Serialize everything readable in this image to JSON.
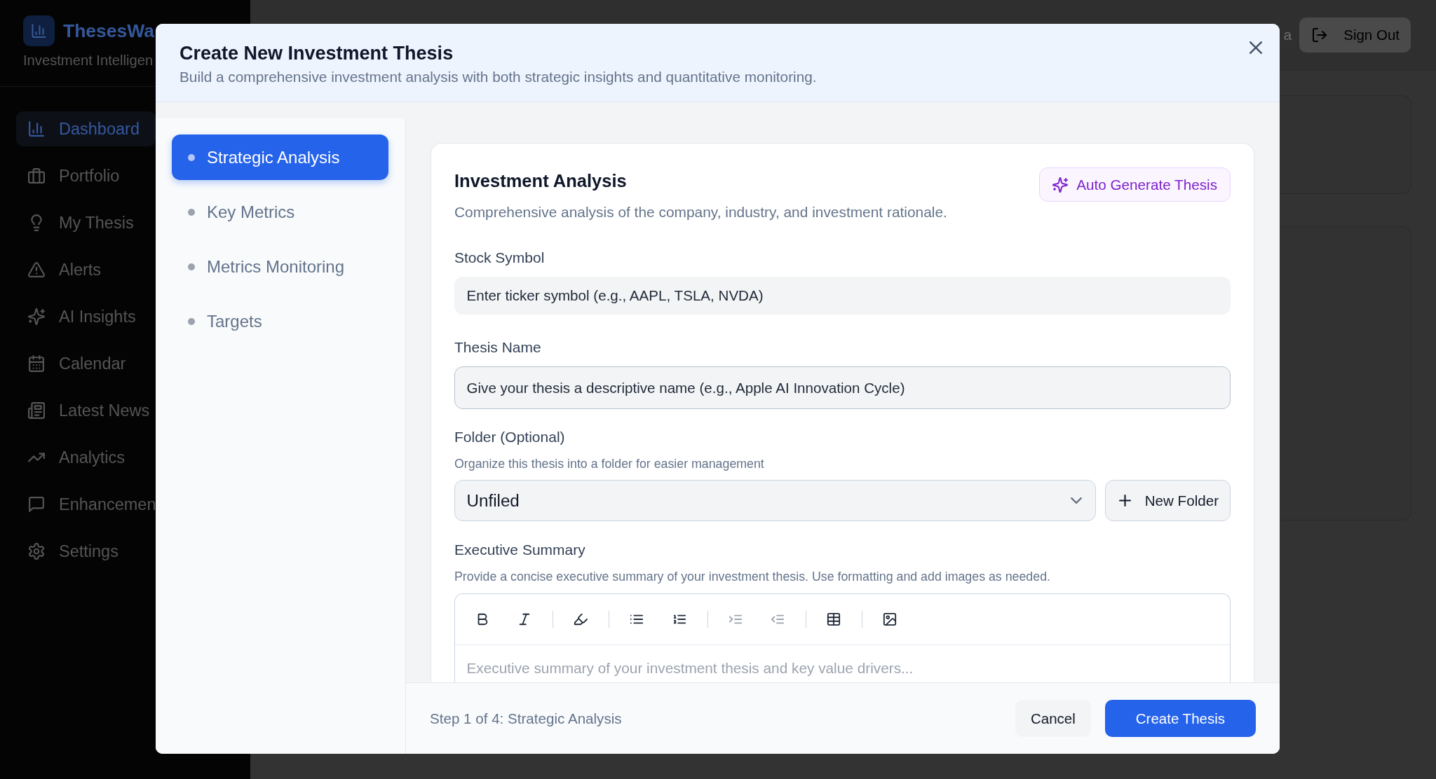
{
  "app": {
    "brand": "ThesesWa",
    "tagline": "Investment Intelligen",
    "nav": [
      {
        "label": "Dashboard",
        "selected": true
      },
      {
        "label": "Portfolio",
        "selected": false
      },
      {
        "label": "My Thesis",
        "selected": false
      },
      {
        "label": "Alerts",
        "selected": false
      },
      {
        "label": "AI Insights",
        "selected": false
      },
      {
        "label": "Calendar",
        "selected": false
      },
      {
        "label": "Latest News",
        "selected": false
      },
      {
        "label": "Analytics",
        "selected": false
      },
      {
        "label": "Enhancemen",
        "selected": false
      },
      {
        "label": "Settings",
        "selected": false
      }
    ],
    "header": {
      "text": "a",
      "button": "Sign Out"
    }
  },
  "dialog": {
    "title": "Create New Investment Thesis",
    "subtitle": "Build a comprehensive investment analysis with both strategic insights and quantitative monitoring.",
    "steps": [
      {
        "label": "Strategic Analysis",
        "selected": true
      },
      {
        "label": "Key Metrics",
        "selected": false
      },
      {
        "label": "Metrics Monitoring",
        "selected": false
      },
      {
        "label": "Targets",
        "selected": false
      }
    ],
    "section": {
      "title": "Investment Analysis",
      "description": "Comprehensive analysis of the company, industry, and investment rationale.",
      "action": "Auto Generate Thesis"
    },
    "stock_symbol": {
      "label": "Stock Symbol",
      "placeholder": "Enter ticker symbol (e.g., AAPL, TSLA, NVDA)"
    },
    "thesis_name": {
      "label": "Thesis Name",
      "placeholder": "Give your thesis a descriptive name (e.g., Apple AI Innovation Cycle)"
    },
    "folder": {
      "label": "Folder (Optional)",
      "hint": "Organize this thesis into a folder for easier management",
      "value": "Unfiled",
      "button": "New Folder"
    },
    "executive_summary": {
      "label": "Executive Summary",
      "hint": "Provide a concise executive summary of your investment thesis. Use formatting and add images as needed.",
      "toolbar": [
        {
          "tools": [
            {
              "kind": "bold",
              "disabled": false
            },
            {
              "kind": "italic",
              "disabled": false
            }
          ]
        },
        {
          "tools": [
            {
              "kind": "highlight",
              "disabled": false
            }
          ]
        },
        {
          "tools": [
            {
              "kind": "bullets",
              "disabled": false
            },
            {
              "kind": "numbered",
              "disabled": false
            }
          ]
        },
        {
          "tools": [
            {
              "kind": "indent",
              "disabled": true
            },
            {
              "kind": "outdent",
              "disabled": true
            }
          ]
        },
        {
          "tools": [
            {
              "kind": "table",
              "disabled": false
            }
          ]
        },
        {
          "tools": [
            {
              "kind": "image",
              "disabled": false
            }
          ]
        }
      ],
      "placeholder": "Executive summary of your investment thesis and key value drivers..."
    },
    "footer": {
      "status": "Step 1 of 4: Strategic Analysis",
      "cancel": "Cancel",
      "submit": "Create Thesis"
    }
  }
}
